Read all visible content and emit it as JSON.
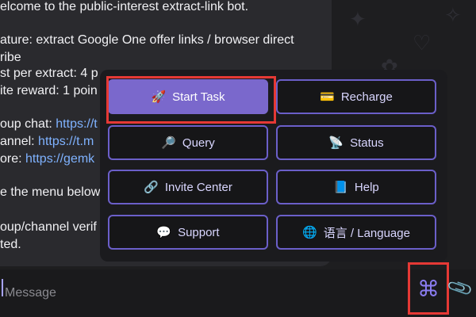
{
  "message": {
    "lines": [
      "elcome to the public-interest extract-link bot.",
      "ature: extract Google One offer links / browser direct",
      "ribe",
      "st per extract: 4 p",
      "ite reward: 1 poin",
      "oup chat: ",
      "annel: ",
      "ore: ",
      "e the menu below",
      "oup/channel verif",
      "ted."
    ],
    "links": {
      "group_chat": "https://t",
      "channel": "https://t.m",
      "more": "https://gemk"
    }
  },
  "keyboard": {
    "buttons": [
      {
        "icon": "🚀",
        "label": "Start Task",
        "icon_name": "rocket-icon"
      },
      {
        "icon": "💳",
        "label": "Recharge",
        "icon_name": "credit-card-icon"
      },
      {
        "icon": "🔎",
        "label": "Query",
        "icon_name": "magnifier-icon"
      },
      {
        "icon": "📡",
        "label": "Status",
        "icon_name": "satellite-dish-icon"
      },
      {
        "icon": "🔗",
        "label": "Invite Center",
        "icon_name": "link-icon"
      },
      {
        "icon": "📘",
        "label": "Help",
        "icon_name": "blue-book-icon"
      },
      {
        "icon": "💬",
        "label": "Support",
        "icon_name": "speech-bubble-icon"
      },
      {
        "icon": "🌐",
        "label": "语言 / Language",
        "icon_name": "globe-icon"
      }
    ]
  },
  "input": {
    "placeholder": "Message",
    "value": ""
  },
  "icons": {
    "command": "⌘",
    "attach": "📎"
  },
  "colors": {
    "accent": "#7a68cc",
    "button_border": "#6b5fc9",
    "link": "#7fb2ff",
    "highlight": "#e53935"
  }
}
